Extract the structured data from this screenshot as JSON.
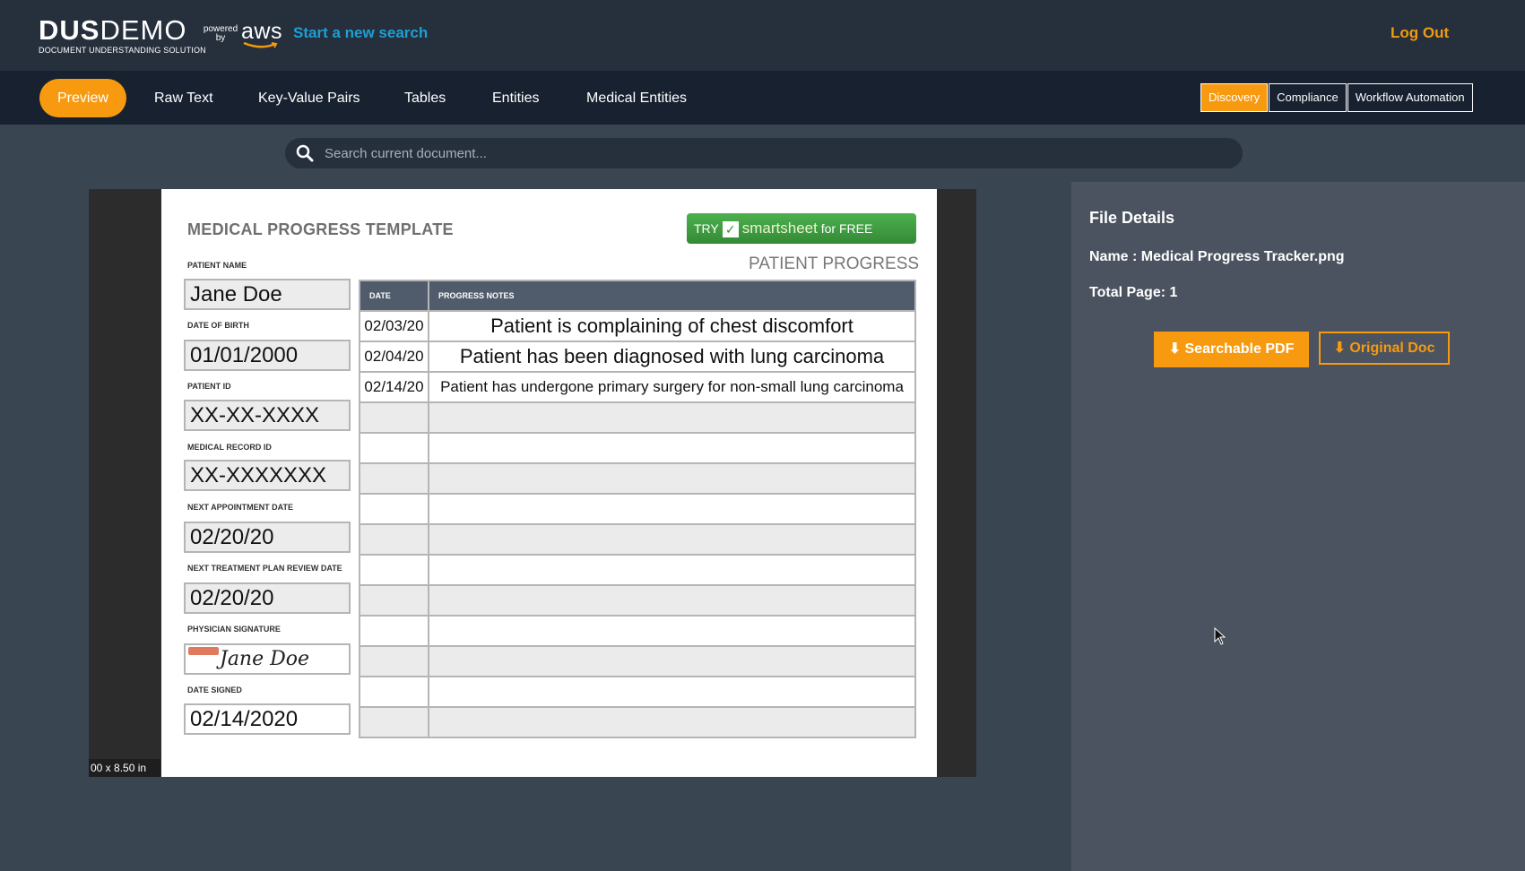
{
  "header": {
    "logo_main_bold": "DUS",
    "logo_main_light": "DEMO",
    "logo_sub": "DOCUMENT UNDERSTANDING SOLUTION",
    "powered_by": "powered by",
    "aws": "aws",
    "new_search": "Start a new search",
    "logout": "Log Out"
  },
  "nav": {
    "tabs": [
      {
        "label": "Preview",
        "active": true
      },
      {
        "label": "Raw Text"
      },
      {
        "label": "Key-Value Pairs"
      },
      {
        "label": "Tables"
      },
      {
        "label": "Entities"
      },
      {
        "label": "Medical Entities"
      }
    ],
    "modes": [
      {
        "label": "Discovery",
        "active": true
      },
      {
        "label": "Compliance"
      },
      {
        "label": "Workflow Automation"
      }
    ]
  },
  "search": {
    "placeholder": "Search current document..."
  },
  "viewer": {
    "size_label": "00 x 8.50 in"
  },
  "document": {
    "title": "MEDICAL PROGRESS TEMPLATE",
    "ad": {
      "try": "TRY",
      "brand": "smartsheet",
      "free": "for FREE"
    },
    "section_title": "PATIENT PROGRESS",
    "fields": [
      {
        "label": "PATIENT NAME",
        "value": "Jane Doe"
      },
      {
        "label": "DATE OF BIRTH",
        "value": "01/01/2000"
      },
      {
        "label": "PATIENT ID",
        "value": "XX-XX-XXXX"
      },
      {
        "label": "MEDICAL RECORD ID",
        "value": "XX-XXXXXXX"
      },
      {
        "label": "NEXT APPOINTMENT DATE",
        "value": "02/20/20"
      },
      {
        "label": "NEXT TREATMENT PLAN REVIEW DATE",
        "value": "02/20/20"
      },
      {
        "label": "PHYSICIAN SIGNATURE",
        "value": "Jane Doe"
      },
      {
        "label": "DATE SIGNED",
        "value": "02/14/2020"
      }
    ],
    "table": {
      "headers": [
        "DATE",
        "PROGRESS NOTES"
      ],
      "rows": [
        {
          "date": "02/03/20",
          "note": "Patient is complaining of chest discomfort"
        },
        {
          "date": "02/04/20",
          "note": "Patient has been diagnosed with lung carcinoma"
        },
        {
          "date": "02/14/20",
          "note": "Patient has undergone primary surgery for non-small lung carcinoma"
        }
      ]
    }
  },
  "panel": {
    "title": "File Details",
    "name": "Name : Medical Progress Tracker.png",
    "pages": "Total Page: 1",
    "btn_pdf": "⬇ Searchable PDF",
    "btn_orig": "⬇ Original Doc"
  },
  "colors": {
    "accent": "#f89a0f",
    "link": "#1ba0d6",
    "header_bg": "#262f3c",
    "nav_bg": "#17212f",
    "body_bg": "#3a4552",
    "panel_bg": "#4a535f"
  }
}
